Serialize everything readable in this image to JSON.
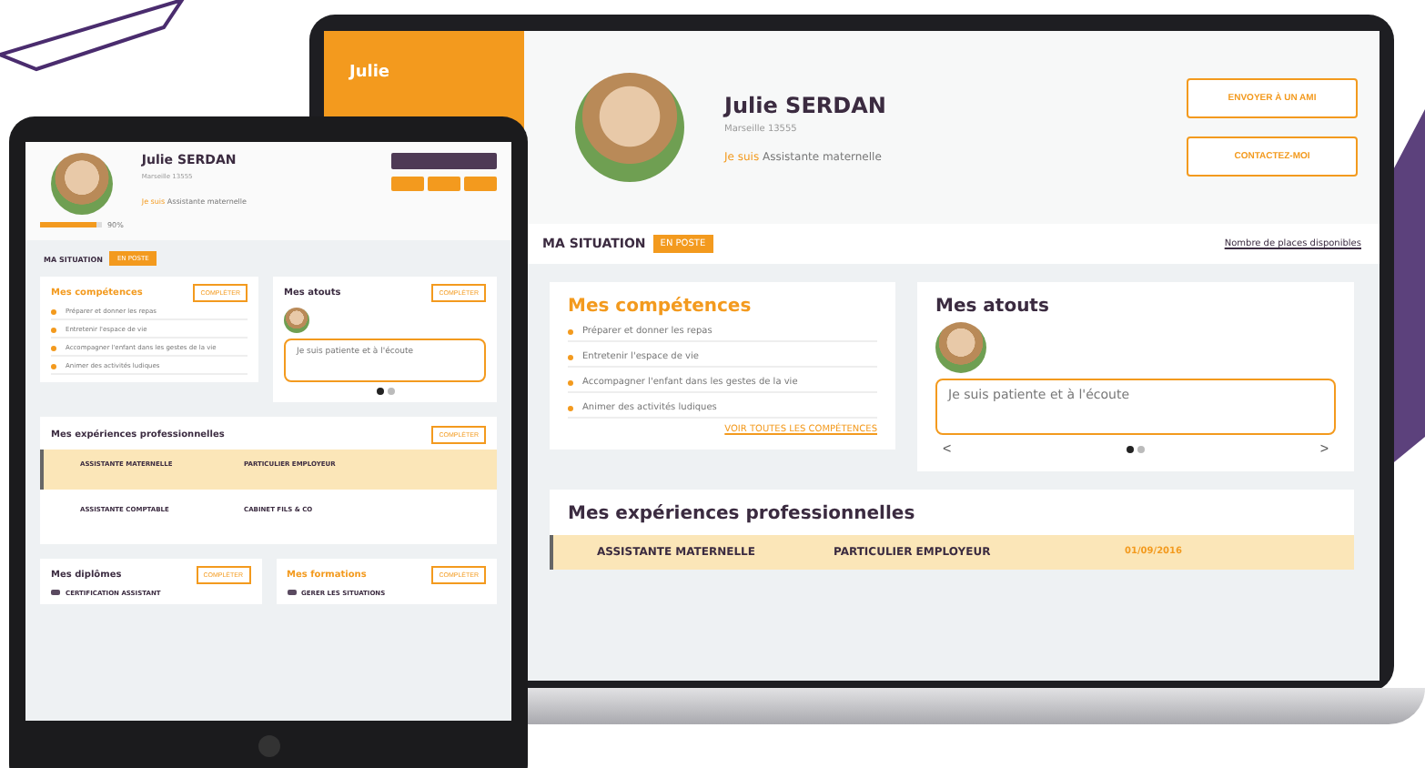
{
  "laptop": {
    "sidebar": {
      "name": "Julie"
    },
    "profile": {
      "name": "Julie SERDAN",
      "city": "Marseille 13555",
      "intro_prefix": "Je suis",
      "intro": "Assistante maternelle"
    },
    "buttons": [
      "ENVOYER À UN AMI",
      "CONTACTEZ-MOI"
    ],
    "situation": {
      "label": "MA SITUATION",
      "status": "EN POSTE",
      "places_link": "Nombre de places disponibles"
    },
    "skills": {
      "title": "Mes compétences",
      "items": [
        "Préparer et donner les repas",
        "Entretenir l'espace de vie",
        "Accompagner l'enfant dans les gestes de la vie",
        "Animer des activités ludiques"
      ],
      "more_link": "VOIR TOUTES LES COMPÉTENCES"
    },
    "strengths": {
      "title": "Mes atouts",
      "quote": "Je suis patiente et à l'écoute",
      "prev": "<",
      "next": ">",
      "pages": [
        {
          "selected": true
        },
        {
          "selected": false
        }
      ]
    },
    "experiences": {
      "title": "Mes expériences professionnelles",
      "rows": [
        {
          "job": "ASSISTANTE MATERNELLE",
          "employer": "PARTICULIER EMPLOYEUR",
          "date": "01/09/2016",
          "selected": true
        }
      ]
    }
  },
  "tablet": {
    "profile": {
      "name": "Julie SERDAN",
      "city": "Marseille 13555",
      "intro_prefix": "Je suis",
      "intro": "Assistante maternelle",
      "progress": {
        "level": 0.9,
        "reading": "90%"
      }
    },
    "situation": {
      "label": "MA SITUATION",
      "status": "EN POSTE"
    },
    "skills": {
      "title": "Mes compétences",
      "action": "COMPLÉTER",
      "items": [
        "Préparer et donner les repas",
        "Entretenir l'espace de vie",
        "Accompagner l'enfant dans les gestes de la vie",
        "Animer des activités ludiques"
      ]
    },
    "strengths": {
      "title": "Mes atouts",
      "action": "COMPLÉTER",
      "quote": "Je suis patiente et à l'écoute",
      "pages": [
        {
          "selected": true
        },
        {
          "selected": false
        }
      ]
    },
    "experiences": {
      "title": "Mes expériences professionnelles",
      "action": "COMPLÉTER",
      "rows": [
        {
          "job": "ASSISTANTE MATERNELLE",
          "employer": "PARTICULIER EMPLOYEUR",
          "selected": true
        },
        {
          "job": "ASSISTANTE COMPTABLE",
          "employer": "CABINET FILS & CO",
          "selected": false
        }
      ]
    },
    "diplomas": {
      "title": "Mes diplômes",
      "action": "COMPLÉTER",
      "entry": "CERTIFICATION ASSISTANT"
    },
    "trainings": {
      "title": "Mes formations",
      "action": "COMPLÉTER",
      "entry": "GERER LES SITUATIONS"
    }
  }
}
